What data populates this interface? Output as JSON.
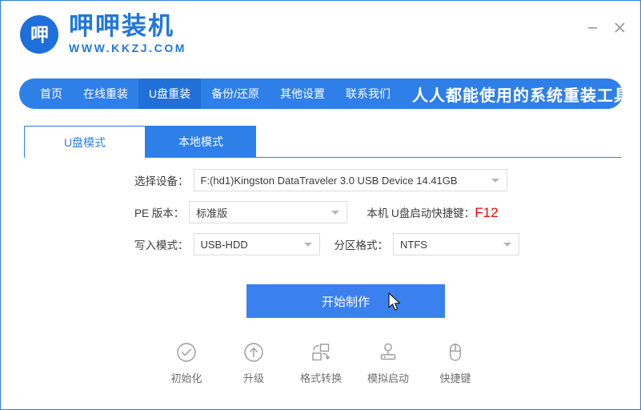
{
  "window": {
    "minimize_label": "—",
    "close_label": "✕"
  },
  "brand": {
    "logo_glyph": "呷",
    "name": "呷呷装机",
    "url": "WWW.KKZJ.COM"
  },
  "nav": {
    "items": [
      {
        "label": "首页",
        "active": false
      },
      {
        "label": "在线重装",
        "active": false
      },
      {
        "label": "U盘重装",
        "active": true
      },
      {
        "label": "备份/还原",
        "active": false
      },
      {
        "label": "其他设置",
        "active": false
      },
      {
        "label": "联系我们",
        "active": false
      }
    ],
    "tagline": "人人都能使用的系统重装工具"
  },
  "tabs": [
    {
      "label": "U盘模式",
      "active": true
    },
    {
      "label": "本地模式",
      "active": false
    }
  ],
  "form": {
    "device": {
      "label": "选择设备：",
      "value": "F:(hd1)Kingston DataTraveler 3.0 USB Device 14.41GB"
    },
    "pe_version": {
      "label": "PE 版本：",
      "value": "标准版"
    },
    "hotkey": {
      "label": "本机 U盘启动快捷键：",
      "value": "F12",
      "color": "#ff0000"
    },
    "write_mode": {
      "label": "写入模式：",
      "value": "USB-HDD"
    },
    "partition_format": {
      "label": "分区格式：",
      "value": "NTFS"
    }
  },
  "action": {
    "start_label": "开始制作"
  },
  "tools": [
    {
      "icon": "check-circle-icon",
      "label": "初始化"
    },
    {
      "icon": "arrow-up-circle-icon",
      "label": "升级"
    },
    {
      "icon": "format-convert-icon",
      "label": "格式转换"
    },
    {
      "icon": "joystick-icon",
      "label": "模拟启动"
    },
    {
      "icon": "mouse-icon",
      "label": "快捷键"
    }
  ],
  "colors": {
    "brand_blue": "#2f7fe8",
    "nav_active": "#2070d8",
    "button_blue": "#3a80ef",
    "alert_red": "#ff0000"
  }
}
